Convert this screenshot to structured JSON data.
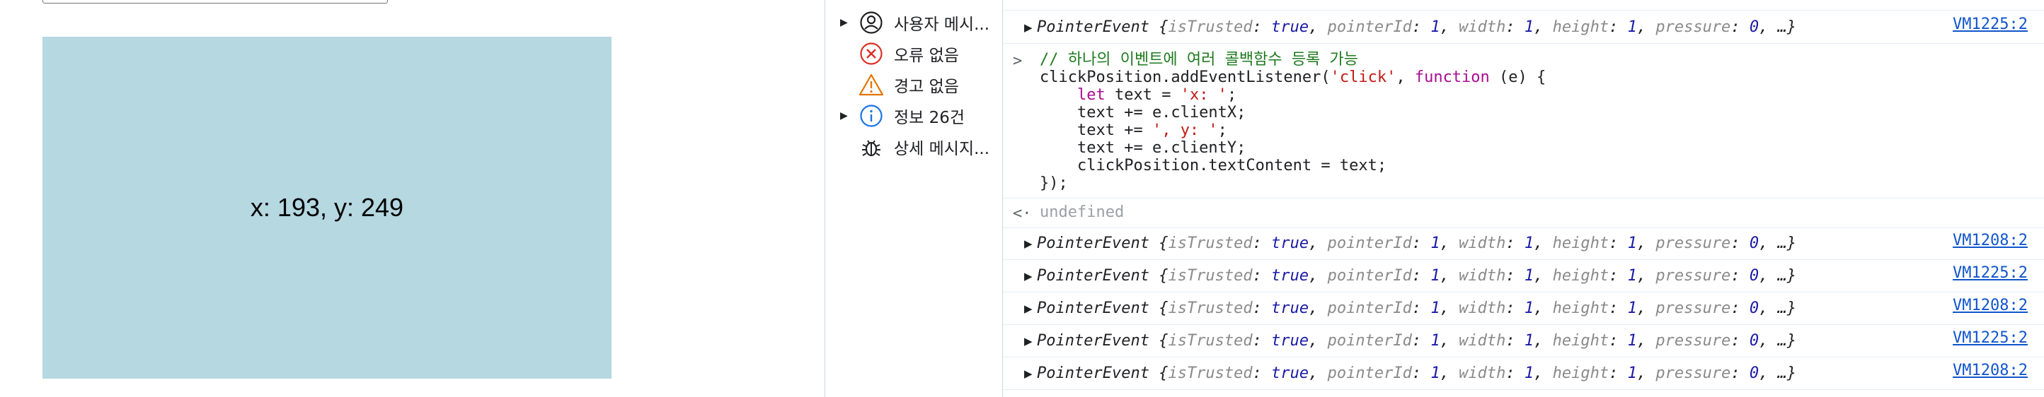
{
  "page": {
    "click_text": "x: 193, y: 249"
  },
  "sidebar": {
    "items": [
      {
        "label": "사용자 메시...",
        "icon": "user-icon",
        "expandable": true
      },
      {
        "label": "오류 없음",
        "icon": "error-icon",
        "expandable": false
      },
      {
        "label": "경고 없음",
        "icon": "warning-icon",
        "expandable": false
      },
      {
        "label": "정보 26건",
        "icon": "info-icon",
        "expandable": true
      },
      {
        "label": "상세 메시지...",
        "icon": "bug-icon",
        "expandable": false
      }
    ]
  },
  "event_preview": {
    "name": "PointerEvent",
    "props": [
      {
        "key": "isTrusted",
        "value": "true"
      },
      {
        "key": "pointerId",
        "value": "1"
      },
      {
        "key": "width",
        "value": "1"
      },
      {
        "key": "height",
        "value": "1"
      },
      {
        "key": "pressure",
        "value": "0"
      }
    ],
    "ellipsis": "…}"
  },
  "console": {
    "top_log_source": "VM1225:2",
    "code_lines": [
      "// 하나의 이벤트에 여러 콜백함수 등록 가능",
      "clickPosition.addEventListener('click', function (e) {",
      "    let text = 'x: ';",
      "    text += e.clientX;",
      "    text += ', y: ';",
      "    text += e.clientY;",
      "    clickPosition.textContent = text;",
      "});"
    ],
    "result": "undefined",
    "logs": [
      {
        "source": "VM1208:2"
      },
      {
        "source": "VM1225:2"
      },
      {
        "source": "VM1208:2"
      },
      {
        "source": "VM1225:2"
      },
      {
        "source": "VM1208:2"
      }
    ]
  },
  "colors": {
    "click_box": "#b5d8e1",
    "link": "#1155cc",
    "error": "#d93025",
    "warning": "#e37400",
    "info": "#1a73e8"
  }
}
